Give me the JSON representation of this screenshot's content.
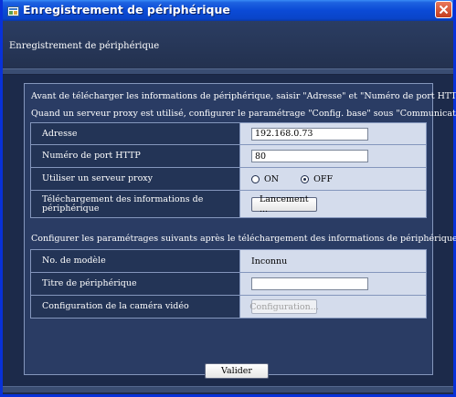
{
  "window": {
    "title": "Enregistrement de périphérique",
    "icon": "app-icon"
  },
  "header": {
    "text": "Enregistrement de périphérique"
  },
  "notes": {
    "line1": "Avant de télécharger les informations de périphérique, saisir \"Adresse\" et \"Numéro de port HTTP \".",
    "line2": "Quand un serveur proxy est utilisé, configurer le paramétrage \"Config. base\" sous \"Communication\".",
    "line3": "Configurer les paramétrages suivants après le téléchargement des informations de périphérique."
  },
  "form": {
    "address_label": "Adresse",
    "address_value": "192.168.0.73",
    "port_label": "Numéro de port HTTP",
    "port_value": "80",
    "proxy_label": "Utiliser un serveur proxy",
    "proxy_on": "ON",
    "proxy_off": "OFF",
    "proxy_selected": "OFF",
    "download_label": "Téléchargement des informations de périphérique",
    "download_button": "Lancement ...",
    "model_label": "No. de modèle",
    "model_value": "Inconnu",
    "device_title_label": "Titre de périphérique",
    "device_title_value": "",
    "camera_config_label": "Configuration de la caméra vidéo",
    "camera_config_button": "Configuration..."
  },
  "footer": {
    "submit_label": "Valider"
  },
  "colors": {
    "titlebar": "#0b4ad6",
    "panel_bg": "#2a3c64",
    "value_cell": "#d4dcec",
    "close_button": "#c43c1c"
  }
}
